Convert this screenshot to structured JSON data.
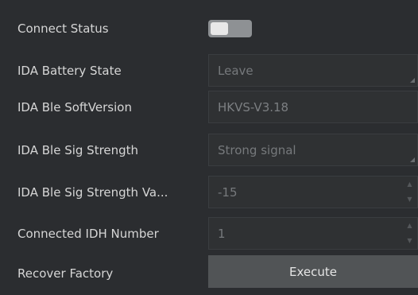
{
  "rows": [
    {
      "label": "Connect Status",
      "type": "toggle",
      "toggle_on": false
    },
    {
      "label": "IDA Battery State",
      "type": "select",
      "value": "Leave"
    },
    {
      "label": "IDA Ble SoftVersion",
      "type": "text",
      "value": "HKVS-V3.18"
    },
    {
      "label": "IDA Ble Sig Strength",
      "type": "select",
      "value": "Strong signal"
    },
    {
      "label": "IDA Ble Sig Strength Va...",
      "type": "spinbox",
      "value": "-15"
    },
    {
      "label": "Connected IDH Number",
      "type": "spinbox",
      "value": "1"
    },
    {
      "label": "Recover Factory",
      "type": "button",
      "button_label": "Execute"
    }
  ],
  "icons": {
    "spin_up": "▲",
    "spin_down": "▼",
    "dropdown_corner": "corner-triangle-icon"
  },
  "colors": {
    "background": "#2b2d30",
    "label_text": "#d6d6d6",
    "disabled_text": "#76797c",
    "button_bg": "#515456",
    "toggle_bg": "#8e9194"
  }
}
